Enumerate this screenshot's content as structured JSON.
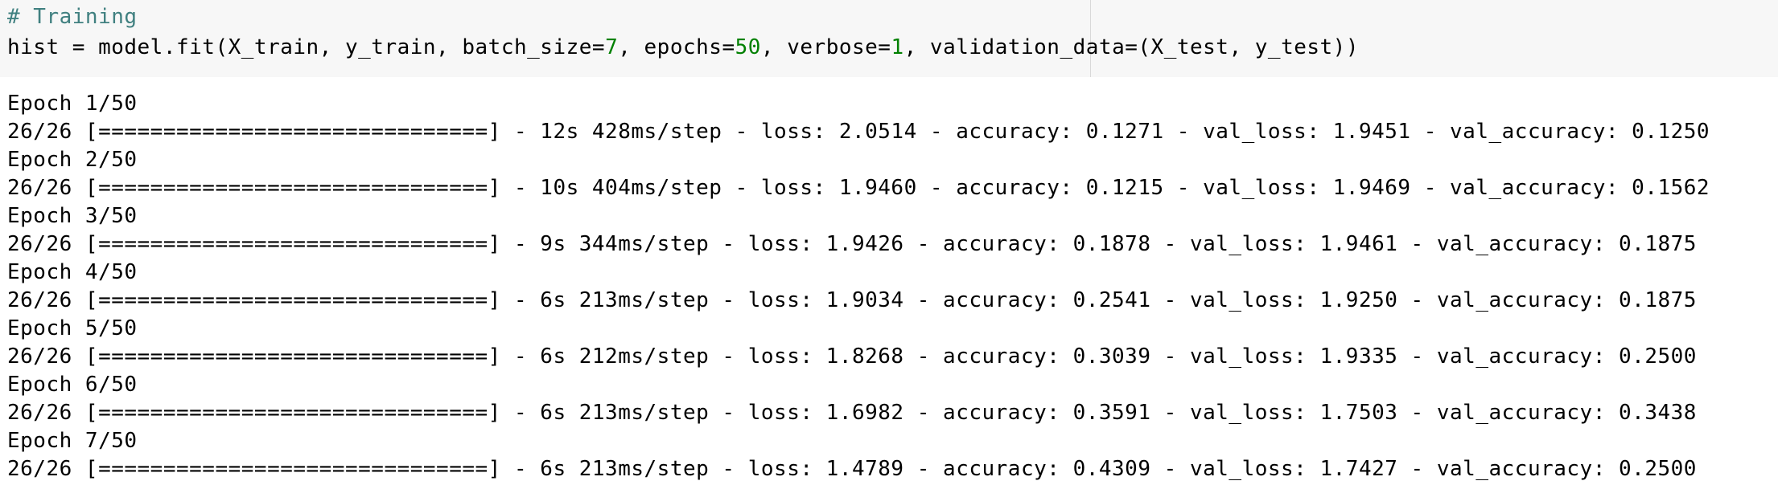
{
  "code_cell": {
    "comment": "# Training",
    "parts": {
      "a": "hist = model.fit(X_train, y_train, batch_size=",
      "batch_size": "7",
      "b": ", epochs=",
      "epochs": "50",
      "c": ", verbose=",
      "verbose": "1",
      "d": ", validation_data=(X_test, y_test))"
    }
  },
  "output": {
    "lines": [
      "Epoch 1/50",
      "26/26 [==============================] - 12s 428ms/step - loss: 2.0514 - accuracy: 0.1271 - val_loss: 1.9451 - val_accuracy: 0.1250",
      "Epoch 2/50",
      "26/26 [==============================] - 10s 404ms/step - loss: 1.9460 - accuracy: 0.1215 - val_loss: 1.9469 - val_accuracy: 0.1562",
      "Epoch 3/50",
      "26/26 [==============================] - 9s 344ms/step - loss: 1.9426 - accuracy: 0.1878 - val_loss: 1.9461 - val_accuracy: 0.1875",
      "Epoch 4/50",
      "26/26 [==============================] - 6s 213ms/step - loss: 1.9034 - accuracy: 0.2541 - val_loss: 1.9250 - val_accuracy: 0.1875",
      "Epoch 5/50",
      "26/26 [==============================] - 6s 212ms/step - loss: 1.8268 - accuracy: 0.3039 - val_loss: 1.9335 - val_accuracy: 0.2500",
      "Epoch 6/50",
      "26/26 [==============================] - 6s 213ms/step - loss: 1.6982 - accuracy: 0.3591 - val_loss: 1.7503 - val_accuracy: 0.3438",
      "Epoch 7/50",
      "26/26 [==============================] - 6s 213ms/step - loss: 1.4789 - accuracy: 0.4309 - val_loss: 1.7427 - val_accuracy: 0.2500"
    ]
  },
  "colors": {
    "comment": "#408080",
    "number": "#008000",
    "cell_background": "#f7f7f7"
  }
}
